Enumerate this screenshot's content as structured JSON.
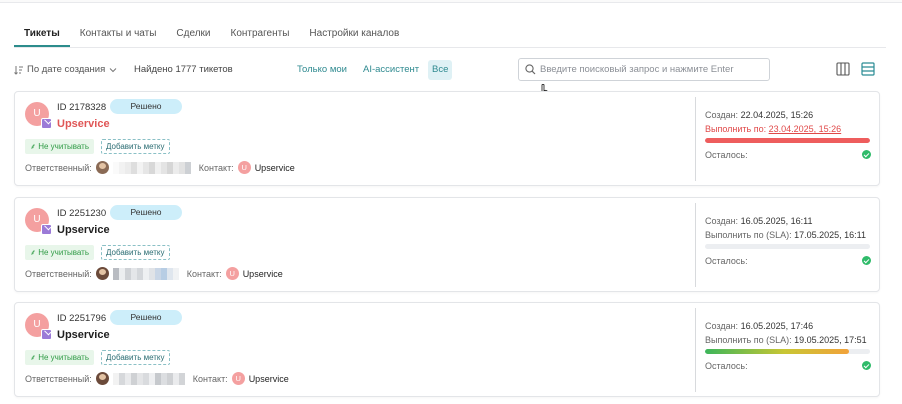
{
  "tabs": [
    "Тикеты",
    "Контакты и чаты",
    "Сделки",
    "Контрагенты",
    "Настройки каналов"
  ],
  "toolbar": {
    "sort_label": "По дате создания",
    "found_label": "Найдено 1777 тикетов",
    "filters": [
      "Только мои",
      "AI-ассистент",
      "Все"
    ],
    "selected_filter": "Все",
    "search_placeholder": "Введите поисковый запрос и нажмите Enter"
  },
  "labels": {
    "responsible": "Ответственный:",
    "contact": "Контакт:",
    "created": "Создан:",
    "remaining": "Осталось:",
    "ignore_tag": "Не учитывать",
    "add_tag": "Добавить метку"
  },
  "tickets": [
    {
      "avatar_letter": "U",
      "id": "ID 2178328",
      "status": "Решено",
      "name": "Upservice",
      "overdue": true,
      "contact_letter": "U",
      "contact_name": "Upservice",
      "created": "22.04.2025, 15:26",
      "deadline_label": "Выполнить по:",
      "deadline": "23.04.2025, 15:26",
      "progress": 1.0,
      "progress_color": "#ee5d5d"
    },
    {
      "avatar_letter": "U",
      "id": "ID 2251230",
      "status": "Решено",
      "name": "Upservice",
      "overdue": false,
      "contact_letter": "U",
      "contact_name": "Upservice",
      "created": "16.05.2025, 16:11",
      "deadline_label": "Выполнить по (SLA):",
      "deadline": "17.05.2025, 16:11",
      "progress": 0.0,
      "progress_color": "#eceef1"
    },
    {
      "avatar_letter": "U",
      "id": "ID 2251796",
      "status": "Решено",
      "name": "Upservice",
      "overdue": false,
      "contact_letter": "U",
      "contact_name": "Upservice",
      "created": "16.05.2025, 17:46",
      "deadline_label": "Выполнить по (SLA):",
      "deadline": "19.05.2025, 17:51",
      "progress": 0.87,
      "progress_color": "gradient"
    }
  ]
}
